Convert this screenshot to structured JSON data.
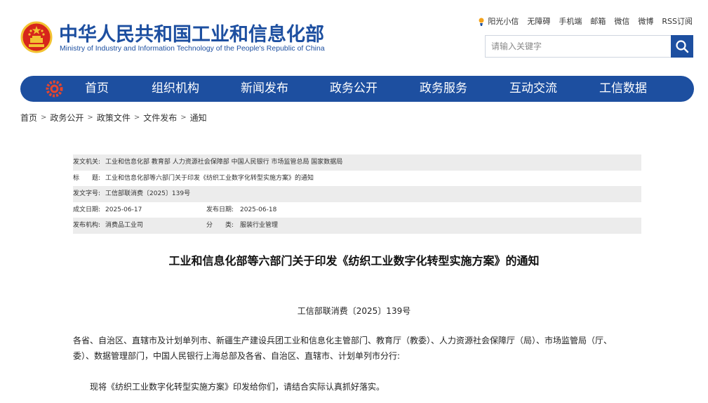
{
  "header": {
    "title_cn": "中华人民共和国工业和信息化部",
    "title_en": "Ministry of Industry and Information Technology of the People's Republic of China"
  },
  "toplinks": [
    "阳光小信",
    "无障碍",
    "手机端",
    "邮箱",
    "微信",
    "微博",
    "RSS订阅"
  ],
  "search": {
    "placeholder": "请输入关键字"
  },
  "nav": [
    "首页",
    "组织机构",
    "新闻发布",
    "政务公开",
    "政务服务",
    "互动交流",
    "工信数据"
  ],
  "breadcrumb": [
    "首页",
    "政务公开",
    "政策文件",
    "文件发布",
    "通知"
  ],
  "meta": {
    "issuer_label": "发文机关:",
    "issuer": "工业和信息化部 教育部 人力资源社会保障部 中国人民银行 市场监管总局 国家数据局",
    "title_label": "标　　题:",
    "title": "工业和信息化部等六部门关于印发《纺织工业数字化转型实施方案》的通知",
    "docno_label": "发文字号:",
    "docno": "工信部联消费〔2025〕139号",
    "written_label": "成文日期:",
    "written": "2025-06-17",
    "published_label": "发布日期:",
    "published": "2025-06-18",
    "org_label": "发布机构:",
    "org": "消费品工业司",
    "category_label": "分　　类:",
    "category": "服装行业管理"
  },
  "article": {
    "title": "工业和信息化部等六部门关于印发《纺织工业数字化转型实施方案》的通知",
    "doc_no": "工信部联消费〔2025〕139号",
    "para1": "各省、自治区、直辖市及计划单列市、新疆生产建设兵团工业和信息化主管部门、教育厅（教委）、人力资源社会保障厅（局）、市场监管局（厅、委）、数据管理部门，中国人民银行上海总部及各省、自治区、直辖市、计划单列市分行:",
    "para2": "现将《纺织工业数字化转型实施方案》印发给你们，请结合实际认真抓好落实。"
  },
  "colors": {
    "brand_blue": "#1d4fa0",
    "emblem_red": "#d7261b",
    "emblem_gold": "#f3c332"
  }
}
